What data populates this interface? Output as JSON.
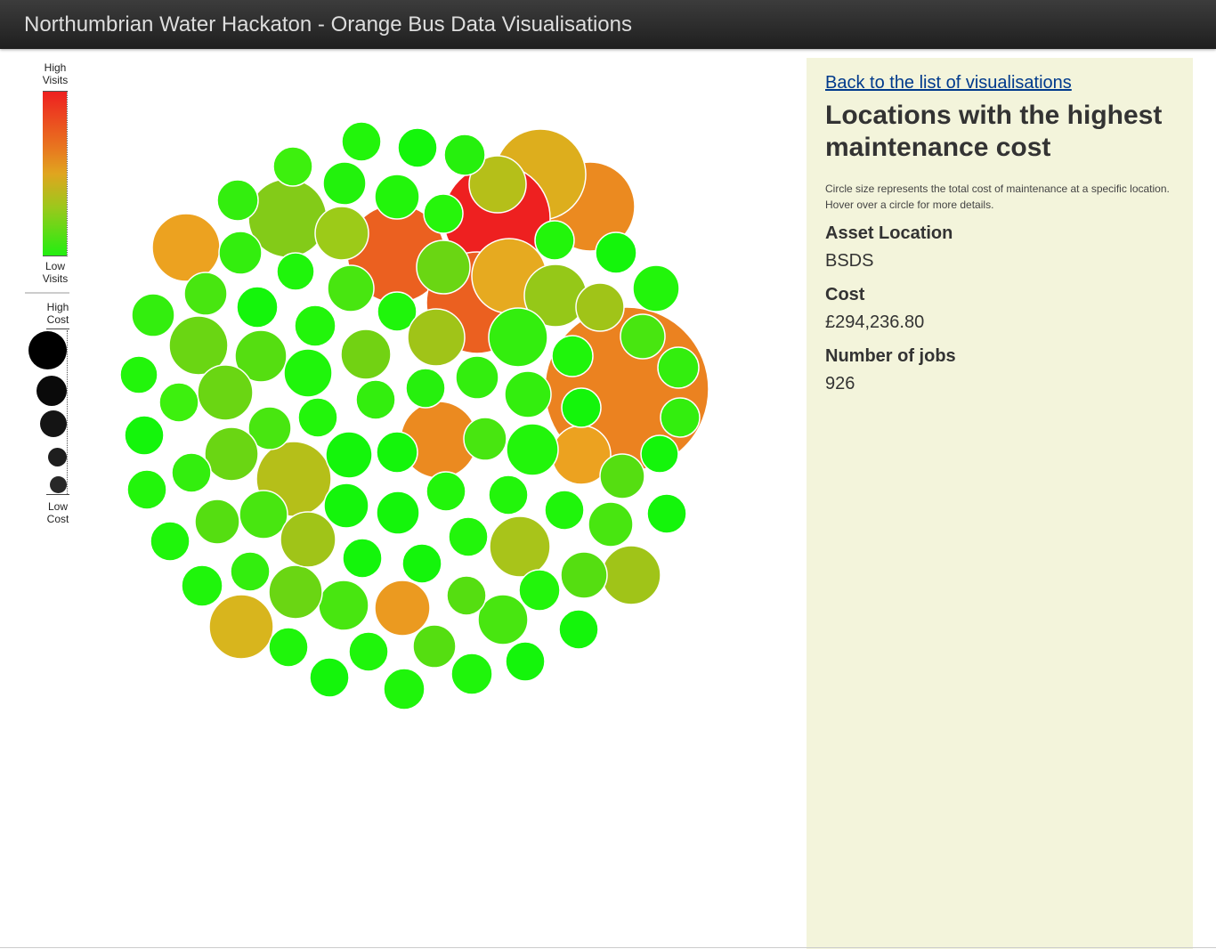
{
  "navbar": {
    "title": "Northumbrian Water Hackaton - Orange Bus Data Visualisations"
  },
  "legend": {
    "visits_high": "High Visits",
    "visits_low": "Low Visits",
    "cost_high": "High Cost",
    "cost_low": "Low Cost",
    "gradient_colors": [
      "#ee2020",
      "#e8781f",
      "#e0a51f",
      "#9ec71c",
      "#22ee11"
    ]
  },
  "panel": {
    "back_link": "Back to the list of visualisations",
    "title": "Locations with the highest maintenance cost",
    "description": "Circle size represents the total cost of maintenance at a specific location. Hover over a circle for more details.",
    "asset_location_label": "Asset Location",
    "asset_location_value": "BSDS",
    "cost_label": "Cost",
    "cost_value": "£294,236.80",
    "jobs_label": "Number of jobs",
    "jobs_value": "926"
  },
  "colors": {
    "panel_bg": "#f3f4db",
    "link": "#003a8c",
    "navbar": "#2b2b2b"
  }
}
